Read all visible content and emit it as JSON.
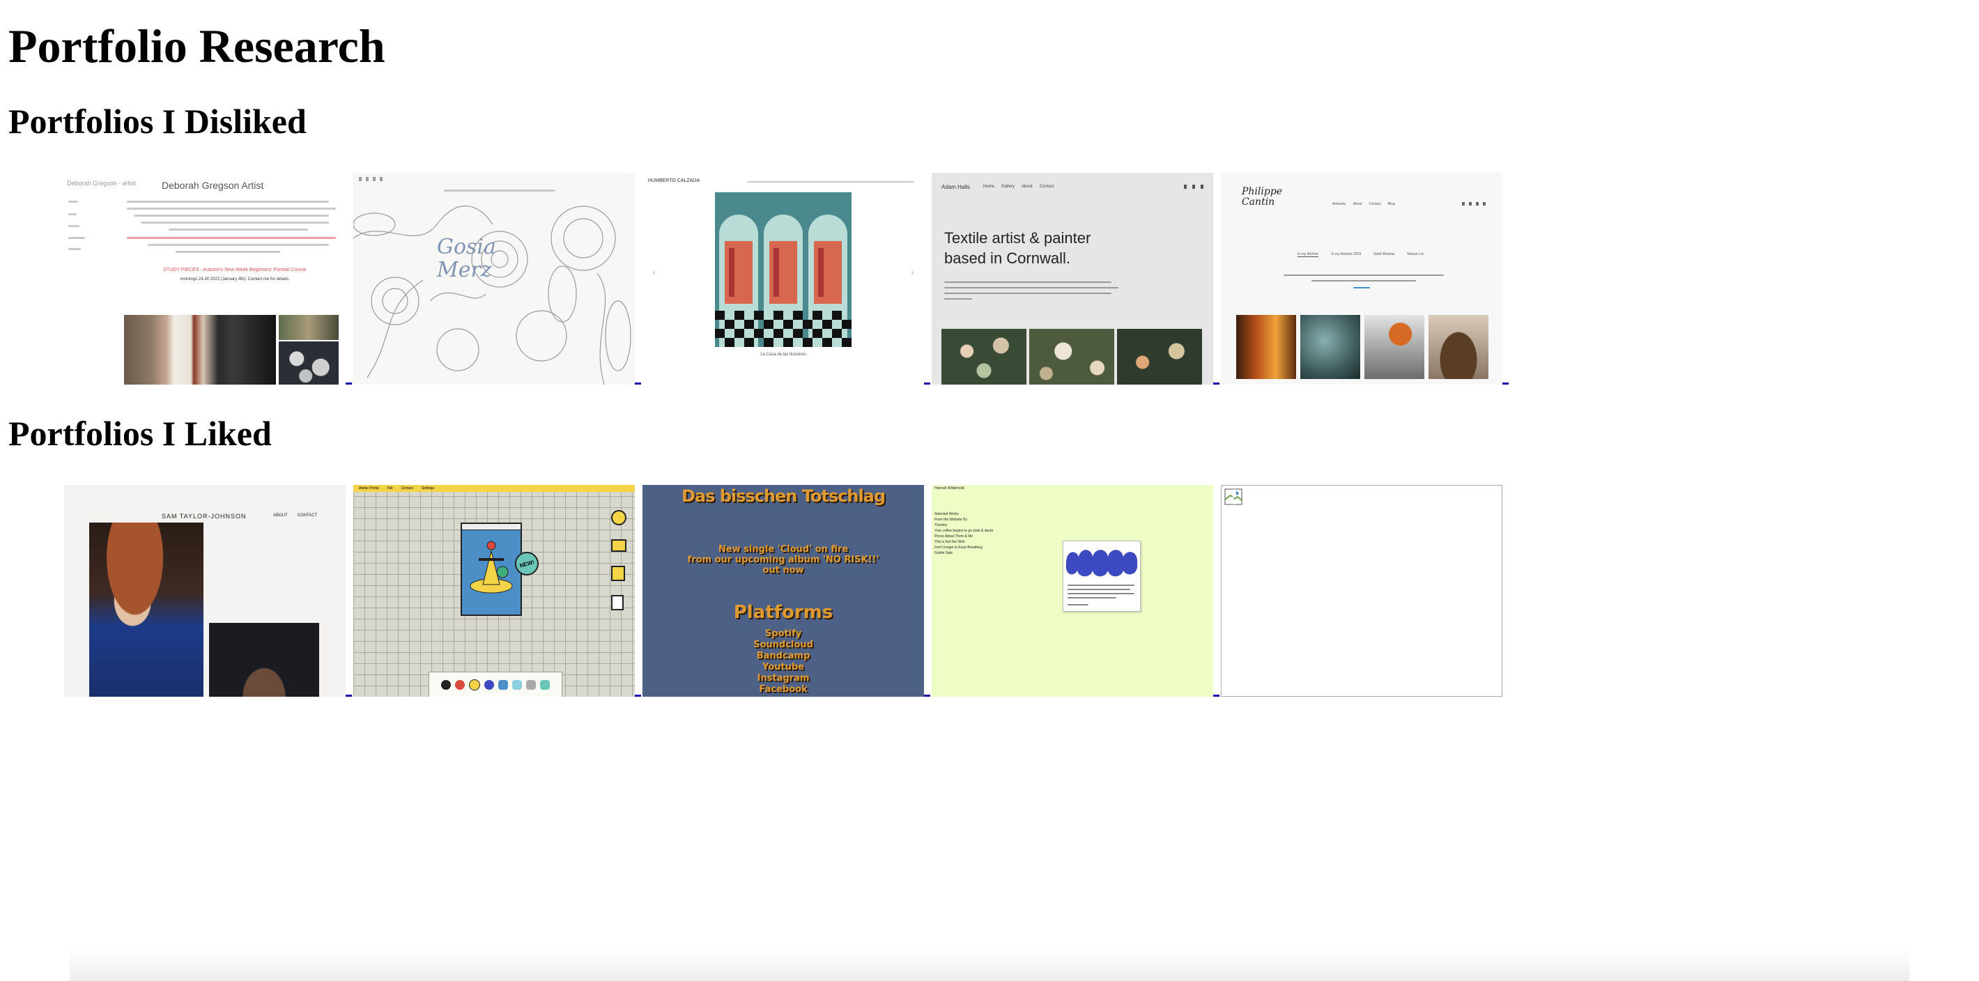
{
  "page": {
    "title": "Portfolio Research",
    "sections": {
      "disliked": "Portfolios I Disliked",
      "liked": "Portfolios I Liked"
    }
  },
  "disliked": [
    {
      "id": "deborah",
      "heading": "Deborah Gregson Artist",
      "corner": "Deborah Gregson - artist",
      "headline": "STUDY PIECES - Autumn's New Week Beginners' Portrait Course",
      "sub": "mornings 24-30 2022 (January 4th). Contact me for details."
    },
    {
      "id": "gosia",
      "signature": "Gosia Merz"
    },
    {
      "id": "humberto",
      "brand": "HUMBERTO CALZADA",
      "caption": "La Casa de las Ilusiones"
    },
    {
      "id": "adam",
      "brand": "Adam Halls",
      "nav": [
        "Home",
        "Gallery",
        "About",
        "Contact"
      ],
      "headline": "Textile artist & painter based in Cornwall."
    },
    {
      "id": "philippe",
      "signature": "Philippe Cantin",
      "nav": [
        "Artworks",
        "About",
        "Contact",
        "Blog"
      ],
      "tabs": [
        "In my Kitchen",
        "In my Kitchen 2009",
        "Solid Window",
        "Mouse Lot"
      ]
    }
  ],
  "liked": [
    {
      "id": "sam",
      "brand": "SAM TAYLOR-JOHNSON",
      "nav": [
        "ABOUT",
        "CONTACT"
      ]
    },
    {
      "id": "mac",
      "menubar": [
        "Atelier Portal",
        "File",
        "Contact",
        "Settings"
      ],
      "badge": "NEW!"
    },
    {
      "id": "totschlag",
      "title": "Das bisschen Totschlag",
      "lines": [
        "New single 'Cloud' on fire",
        "from our upcoming album 'NO RISK!!'",
        "out now"
      ],
      "platforms_title": "Platforms",
      "platforms": [
        "Spotify",
        "Soundcloud",
        "Bandcamp",
        "Youtube",
        "Instagram",
        "Facebook"
      ]
    },
    {
      "id": "hannah",
      "brand": "Hannah Wilderhold",
      "menu": [
        "Selected Works",
        "From the Website Dy",
        "Thereby",
        "Your coffee begins to go stale & dumb",
        "Prices About Them & Me",
        "This is Not the Web",
        "Don't Forget to Keep Breathing",
        "Goblin Safe"
      ]
    },
    {
      "id": "broken"
    }
  ],
  "colors": {
    "link": "#1a0dab",
    "grid_bg": "#d8d8cf",
    "band_blue": "#4c6185",
    "totschlag_text": "#e09a32",
    "hannah_bg": "#eefcc6",
    "mac_bar": "#f3d348",
    "icon_blue": "#3c49c0"
  }
}
